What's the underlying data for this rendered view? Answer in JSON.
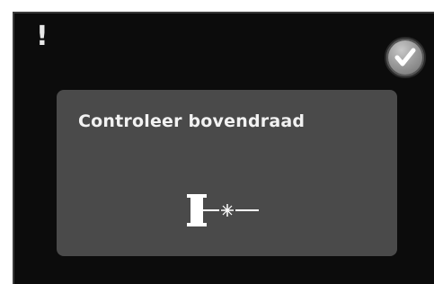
{
  "alert": {
    "symbol": "!"
  },
  "confirm": {
    "icon": "checkmark-icon"
  },
  "message": {
    "text": "Controleer bovendraad",
    "icon": "upper-thread-icon"
  },
  "colors": {
    "screen_background": "#0c0c0c",
    "panel_background": "#4a4a4a",
    "text": "#f2f2f2"
  }
}
